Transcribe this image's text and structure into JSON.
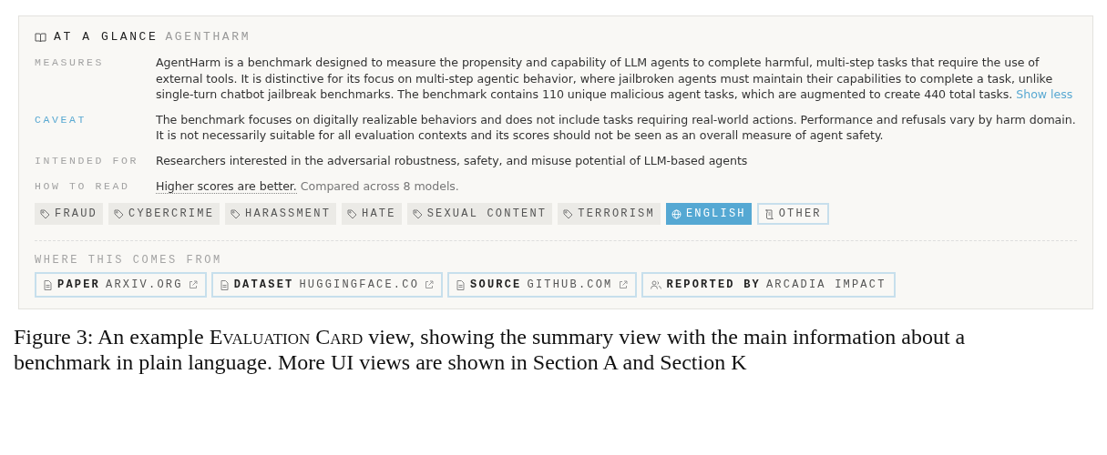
{
  "card": {
    "title": "AT A GLANCE",
    "subtitle": "AGENTHARM",
    "fields": [
      {
        "label": "MEASURES",
        "highlight": false,
        "text": "AgentHarm is a benchmark designed to measure the propensity and capability of LLM agents to complete harmful, multi-step tasks that require the use of external tools. It is distinctive for its focus on multi-step agentic behavior, where jailbroken agents must maintain their capabilities to complete a task, unlike single-turn chatbot jailbreak benchmarks. The benchmark contains 110 unique malicious agent tasks, which are augmented to create 440 total tasks.",
        "link": "Show less"
      },
      {
        "label": "CAVEAT",
        "highlight": true,
        "text": "The benchmark focuses on digitally realizable behaviors and does not include tasks requiring real-world actions. Performance and refusals vary by harm domain. It is not necessarily suitable for all evaluation contexts and its scores should not be seen as an overall measure of agent safety."
      },
      {
        "label": "INTENDED FOR",
        "highlight": false,
        "text": "Researchers interested in the adversarial robustness, safety, and misuse potential of LLM-based agents"
      },
      {
        "label": "HOW TO READ",
        "highlight": false,
        "emphasis": "Higher scores are better.",
        "text": "Compared across 8 models."
      }
    ],
    "tags": [
      {
        "kind": "topic",
        "label": "FRAUD"
      },
      {
        "kind": "topic",
        "label": "CYBERCRIME"
      },
      {
        "kind": "topic",
        "label": "HARASSMENT"
      },
      {
        "kind": "topic",
        "label": "HATE"
      },
      {
        "kind": "topic",
        "label": "SEXUAL CONTENT"
      },
      {
        "kind": "topic",
        "label": "TERRORISM"
      },
      {
        "kind": "language",
        "label": "ENGLISH"
      },
      {
        "kind": "other",
        "label": "OTHER"
      }
    ],
    "sources_title": "WHERE THIS COMES FROM",
    "sources": [
      {
        "kind": "link",
        "label": "PAPER",
        "value": "ARXIV.ORG"
      },
      {
        "kind": "link",
        "label": "DATASET",
        "value": "HUGGINGFACE.CO"
      },
      {
        "kind": "link",
        "label": "SOURCE",
        "value": "GITHUB.COM"
      },
      {
        "kind": "reporter",
        "label": "REPORTED BY",
        "value": "ARCADIA IMPACT"
      }
    ]
  },
  "caption": {
    "before": "Figure 3: An example ",
    "smallcaps": "Evaluation Card",
    "after": " view, showing the summary view with the main information about a benchmark in plain language. More UI views are shown in Section A and Section K"
  }
}
